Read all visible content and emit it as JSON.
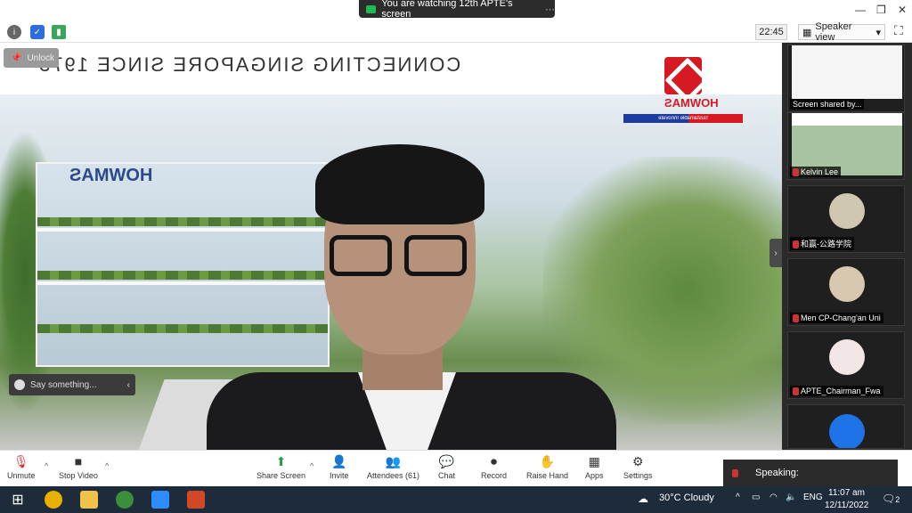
{
  "banner": {
    "text": "You are watching 12th APTE's screen"
  },
  "toolbar": {
    "time": "22:45",
    "view_label": "Speaker view"
  },
  "stage": {
    "slide_title": "CONNECTING SINGAPORE SINCE 1975",
    "unlock_label": "Unlock",
    "logo_name": "HOWMAS",
    "logo_strip": "Sustainable  Innovate",
    "building_name": "HOWMAS",
    "chat_placeholder": "Say something..."
  },
  "panel": {
    "tiles": [
      {
        "label": "Screen shared by..."
      },
      {
        "label": "Kelvin Lee"
      },
      {
        "label": "和赢-公路学院"
      },
      {
        "label": "Men CP-Chang'an Uni"
      },
      {
        "label": "APTE_Chairman_Fwa"
      }
    ]
  },
  "controls": {
    "unmute": "Unmute",
    "stop_video": "Stop Video",
    "share_screen": "Share Screen",
    "invite": "Invite",
    "attendees": "Attendees (61)",
    "chat": "Chat",
    "record": "Record",
    "raise_hand": "Raise Hand",
    "apps": "Apps",
    "settings": "Settings",
    "speaking": "Speaking:"
  },
  "taskbar": {
    "weather": "30°C  Cloudy",
    "lang": "ENG",
    "clock_time": "11:07 am",
    "clock_date": "12/11/2022",
    "notif_count": "2"
  },
  "colors": {
    "accent_red": "#d51a24",
    "brand_blue": "#1e3c9c",
    "taskbar": "#1d2b3a"
  }
}
